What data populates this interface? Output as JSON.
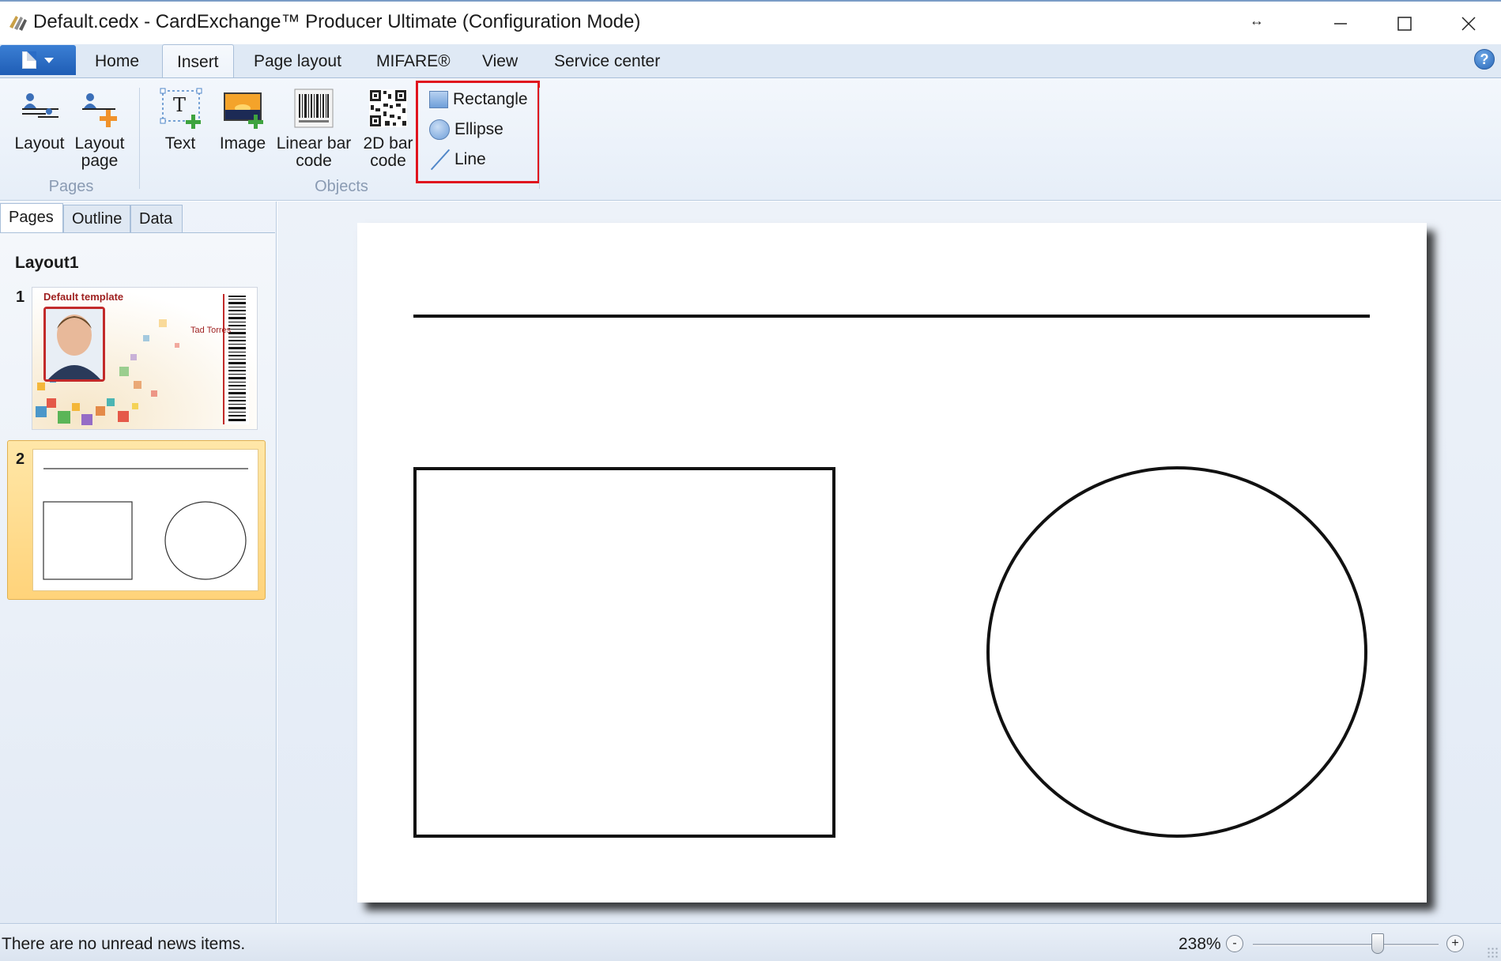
{
  "window": {
    "title": "Default.cedx - CardExchange™ Producer Ultimate (Configuration Mode)",
    "resize_glyph": "↔",
    "minimize_glyph": "—",
    "maximize_glyph": "☐",
    "close_glyph": "✕"
  },
  "ribbon_tabs": [
    "Home",
    "Insert",
    "Page layout",
    "MIFARE®",
    "View",
    "Service center"
  ],
  "active_tab": "Insert",
  "help_label": "?",
  "ribbon": {
    "pages_group": {
      "label": "Pages",
      "buttons": [
        {
          "label_line1": "Layout",
          "label_line2": "",
          "icon": "layout-icon"
        },
        {
          "label_line1": "Layout",
          "label_line2": "page",
          "icon": "layout-page-icon"
        }
      ]
    },
    "objects_group": {
      "label": "Objects",
      "buttons": [
        {
          "label_line1": "Text",
          "label_line2": "",
          "icon": "text-insert-icon"
        },
        {
          "label_line1": "Image",
          "label_line2": "",
          "icon": "image-insert-icon"
        },
        {
          "label_line1": "Linear bar",
          "label_line2": "code",
          "icon": "barcode-icon"
        },
        {
          "label_line1": "2D bar",
          "label_line2": "code",
          "icon": "qr-code-icon"
        }
      ],
      "shapes": [
        {
          "label": "Rectangle",
          "icon": "rectangle-icon"
        },
        {
          "label": "Ellipse",
          "icon": "ellipse-icon"
        },
        {
          "label": "Line",
          "icon": "line-icon"
        }
      ]
    }
  },
  "left_panel": {
    "tabs": [
      "Pages",
      "Outline",
      "Data"
    ],
    "active_tab": "Pages",
    "layout_name": "Layout1",
    "pages": [
      {
        "number": "1",
        "template_title": "Default template",
        "person_name": "Tad Torres"
      },
      {
        "number": "2"
      }
    ]
  },
  "status": {
    "message": "There are no unread news items.",
    "zoom": "238%",
    "zoom_level_percent": 238,
    "zoom_out_label": "-",
    "zoom_in_label": "+"
  },
  "colors": {
    "highlight_box": "#e0141e",
    "selected_page": "#ffd37a",
    "ribbon": "#e6eef8",
    "accent": "#1f5db5"
  }
}
